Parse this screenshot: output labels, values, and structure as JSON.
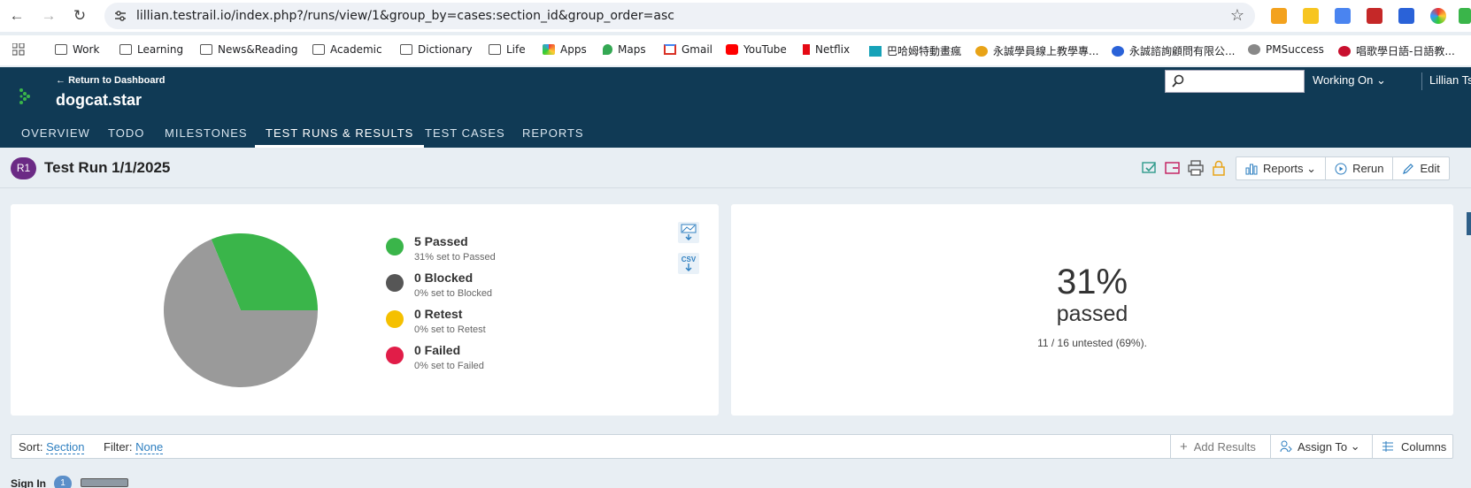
{
  "browser": {
    "url": "lillian.testrail.io/index.php?/runs/view/1&group_by=cases:section_id&group_order=asc",
    "bookmarks": [
      "Work",
      "Learning",
      "News&Reading",
      "Academic",
      "Dictionary",
      "Life",
      "Apps",
      "Maps",
      "Gmail",
      "YouTube",
      "Netflix",
      "巴哈姆特動畫瘋",
      "永誠學員線上教學專...",
      "永誠諮詢顧問有限公...",
      "PMSuccess",
      "唱歌學日語-日語教..."
    ]
  },
  "header": {
    "return_link": "Return to Dashboard",
    "project_name": "dogcat.star",
    "tabs": [
      "OVERVIEW",
      "TODO",
      "MILESTONES",
      "TEST RUNS & RESULTS",
      "TEST CASES",
      "REPORTS"
    ],
    "active_tab": "TEST RUNS & RESULTS",
    "search_placeholder": "",
    "working_on": "Working On",
    "user": "Lillian Tsai"
  },
  "run": {
    "badge": "R1",
    "title": "Test Run 1/1/2025",
    "buttons": {
      "reports": "Reports",
      "rerun": "Rerun",
      "edit": "Edit"
    }
  },
  "chart_data": {
    "type": "pie",
    "categories": [
      "Passed",
      "Blocked",
      "Retest",
      "Failed",
      "Untested"
    ],
    "values": [
      5,
      0,
      0,
      0,
      11
    ],
    "colors": [
      "#3ab54a",
      "#565656",
      "#f5c000",
      "#e11d48",
      "#9a9a9a"
    ]
  },
  "legend": [
    {
      "title": "5 Passed",
      "sub": "31% set to Passed",
      "color": "#3ab54a"
    },
    {
      "title": "0 Blocked",
      "sub": "0% set to Blocked",
      "color": "#565656"
    },
    {
      "title": "0 Retest",
      "sub": "0% set to Retest",
      "color": "#f5c000"
    },
    {
      "title": "0 Failed",
      "sub": "0% set to Failed",
      "color": "#e11d48"
    }
  ],
  "downloads": {
    "csv": "CSV"
  },
  "summary": {
    "percent": "31%",
    "label": "passed",
    "untested": "11 / 16 untested (69%)."
  },
  "sortbar": {
    "sort_label": "Sort:",
    "sort_value": "Section",
    "filter_label": "Filter:",
    "filter_value": "None",
    "add_results": "Add Results",
    "assign_to": "Assign To",
    "columns": "Columns"
  },
  "section": {
    "title": "Sign In",
    "count": "1"
  }
}
